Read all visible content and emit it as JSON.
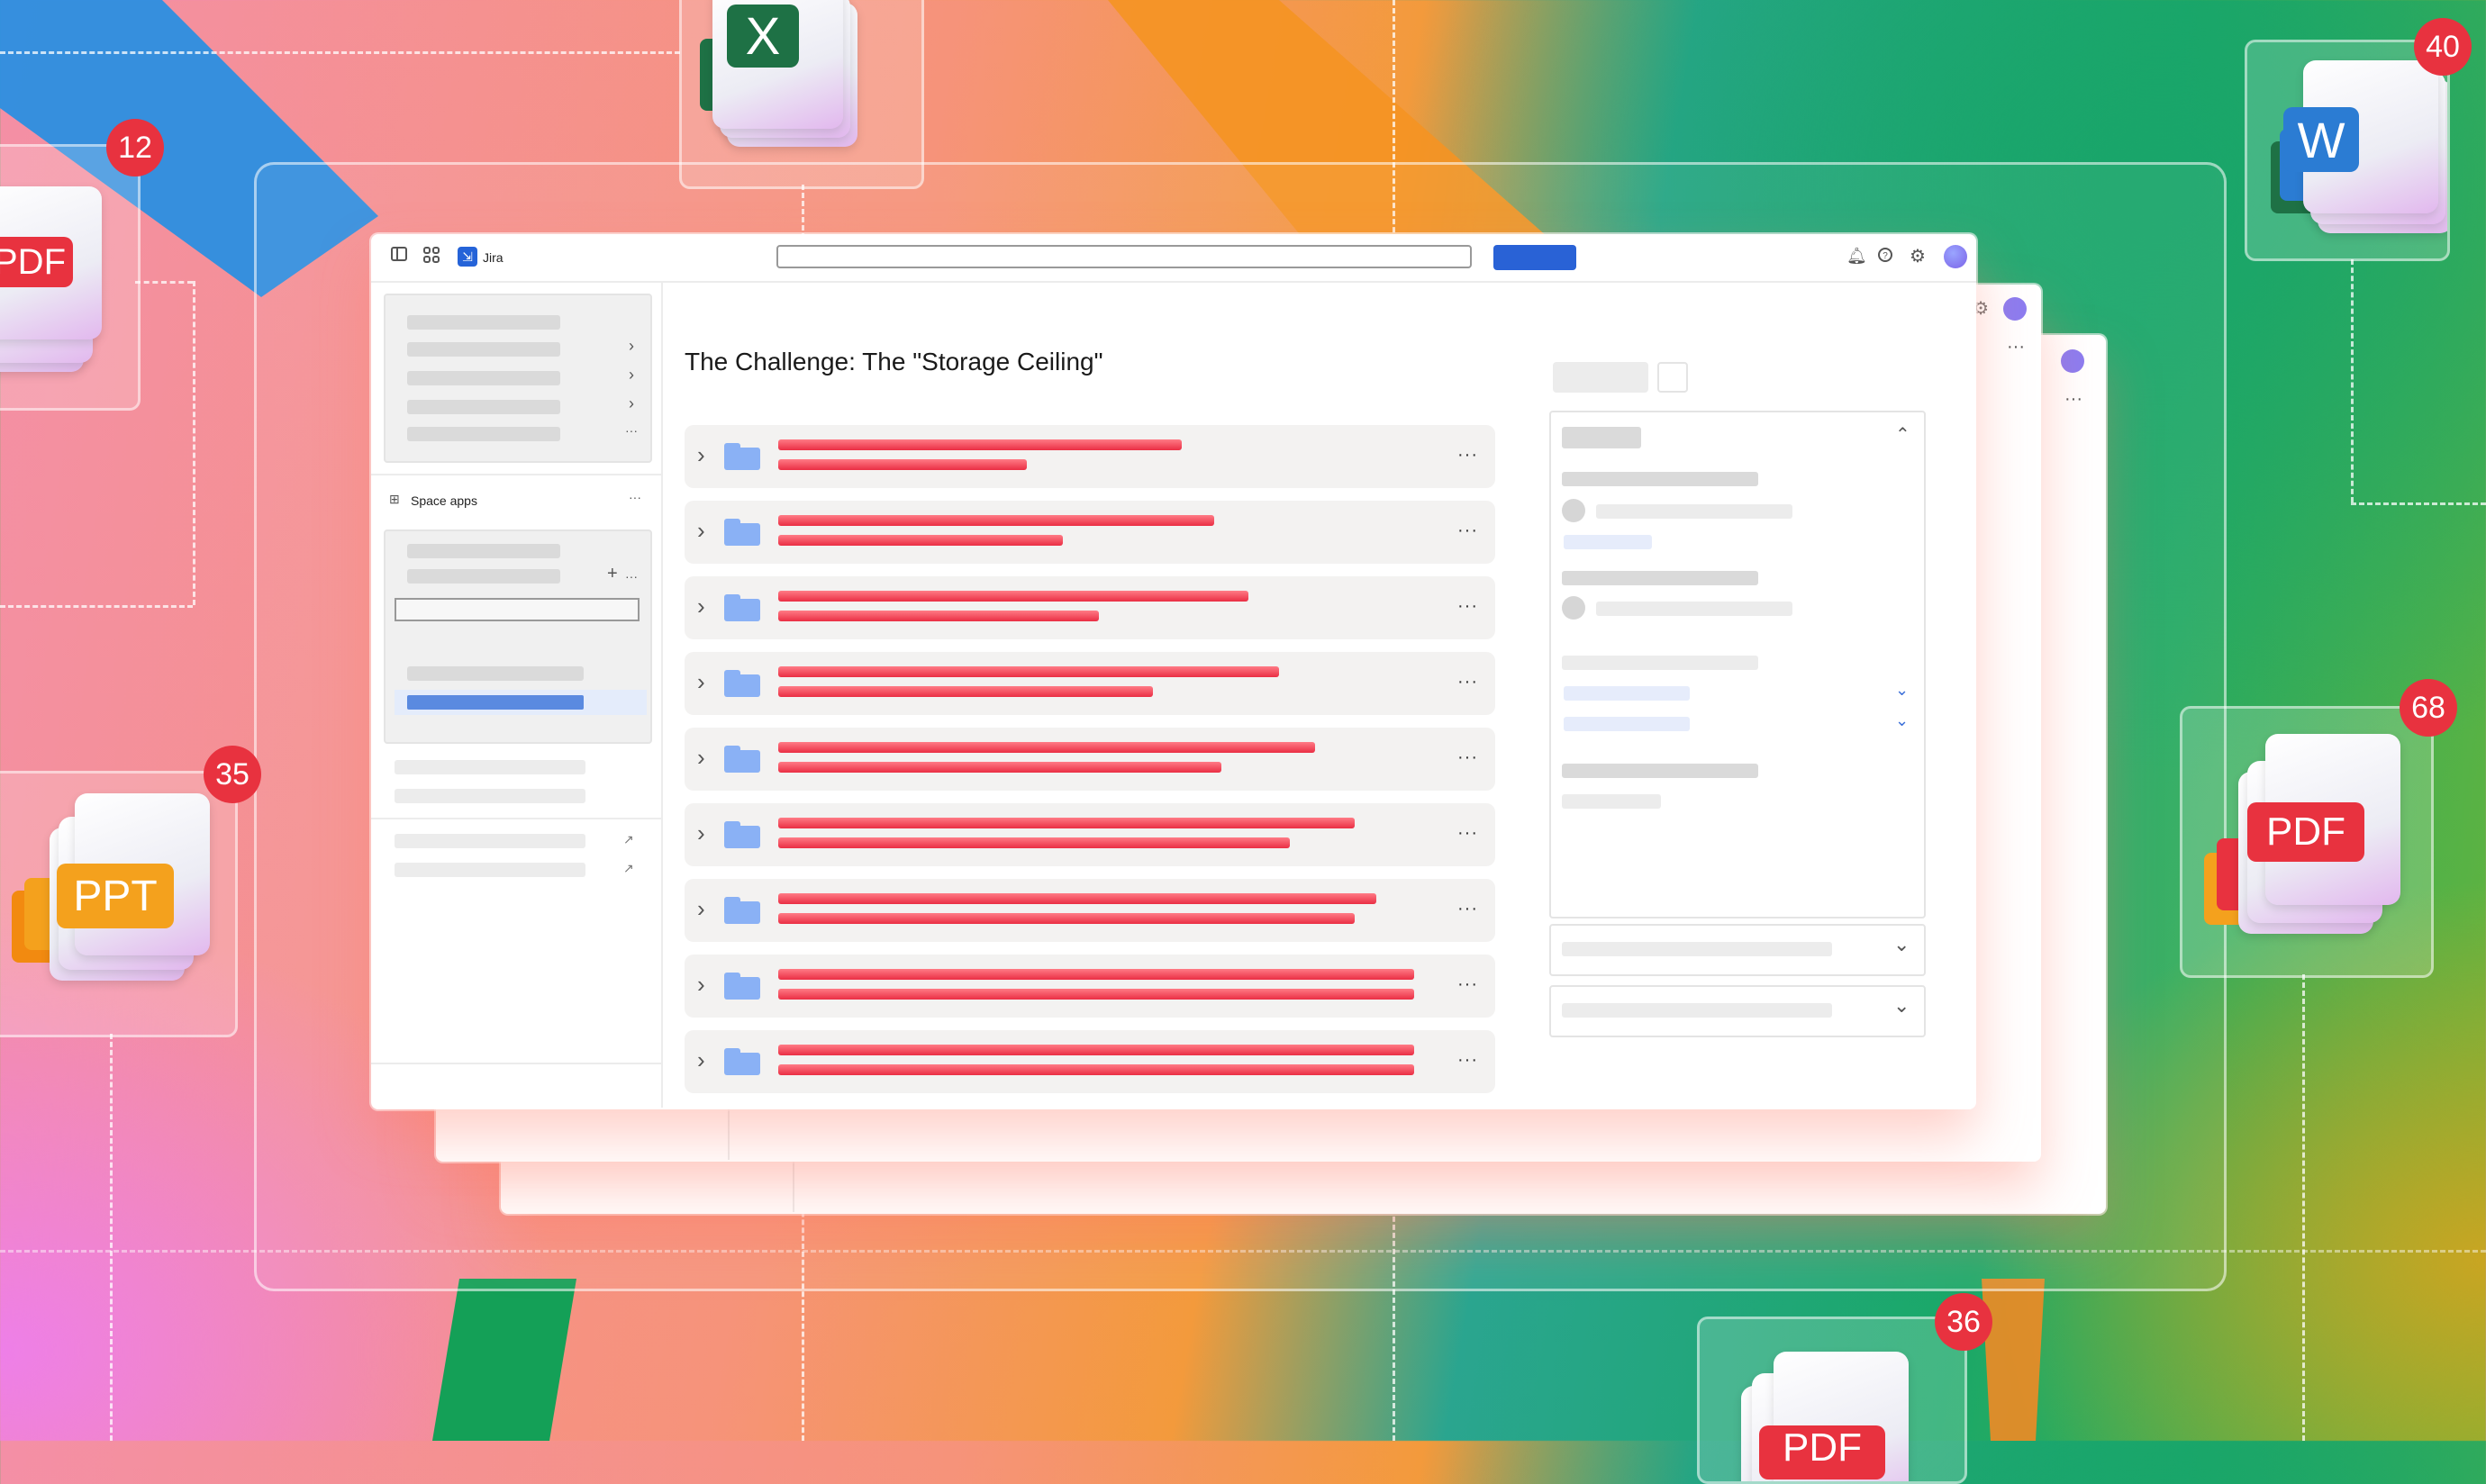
{
  "background": {
    "badges": [
      "12",
      "40",
      "35",
      "68",
      "36"
    ],
    "file_labels": {
      "excel": "X",
      "word": "W",
      "ppt": "PPT",
      "pdf": "PDF"
    },
    "colors": {
      "badge": "#e8323f",
      "excel": "#1e7145",
      "word": "#2b7cd3",
      "ppt": "#f4a11d",
      "pdf": "#e8323f"
    }
  },
  "window": {
    "app_name": "Jira",
    "search": {
      "value": "",
      "placeholder": ""
    },
    "icons": [
      "sidebar-toggle-icon",
      "apps-grid-icon",
      "bell-icon",
      "help-icon",
      "settings-icon",
      "avatar"
    ],
    "sidebar": {
      "section_label": "Space apps",
      "more_glyph": "···",
      "add_glyph": "+"
    },
    "main": {
      "title": "The Challenge: The \"Storage Ceiling\"",
      "row_count": 9,
      "more_glyph": "···"
    },
    "colors": {
      "primary_button": "#2962d6",
      "folder": "#8ab1f5",
      "redacted_bar": "#ea2e44",
      "avatar": "#8c7cf0"
    }
  }
}
